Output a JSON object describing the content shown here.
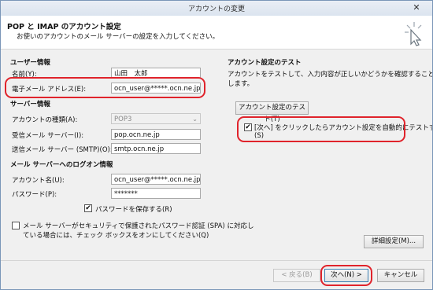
{
  "window": {
    "title": "アカウントの変更",
    "close": "✕"
  },
  "header": {
    "title": "POP と IMAP のアカウント設定",
    "subtitle": "お使いのアカウントのメール サーバーの設定を入力してください。"
  },
  "user_info": {
    "section": "ユーザー情報",
    "name_label": "名前(Y):",
    "name_value": "山田　太郎",
    "email_label": "電子メール アドレス(E):",
    "email_value": "ocn_user@*****.ocn.ne.jp"
  },
  "server_info": {
    "section": "サーバー情報",
    "type_label": "アカウントの種類(A):",
    "type_value": "POP3",
    "incoming_label": "受信メール サーバー(I):",
    "incoming_value": "pop.ocn.ne.jp",
    "outgoing_label": "送信メール サーバー (SMTP)(O):",
    "outgoing_value": "smtp.ocn.ne.jp"
  },
  "logon_info": {
    "section": "メール サーバーへのログオン情報",
    "account_label": "アカウント名(U):",
    "account_value": "ocn_user@*****.ocn.ne.jp",
    "password_label": "パスワード(P):",
    "password_value": "*******",
    "save_password_label": "パスワードを保存する(R)",
    "spa_label_1": "メール サーバーがセキュリティで保護されたパスワード認証 (SPA) に対応し",
    "spa_label_2": "ている場合には、チェック ボックスをオンにしてください(Q)"
  },
  "test": {
    "section": "アカウント設定のテスト",
    "desc_1": "アカウントをテストして、入力内容が正しいかどうかを確認することをお勧め",
    "desc_2": "します。",
    "test_button": "アカウント設定のテスト(T)",
    "auto_test_label_1": "[次へ] をクリックしたらアカウント設定を自動的にテストする",
    "auto_test_label_2": "(S)"
  },
  "buttons": {
    "advanced": "詳細設定(M)...",
    "back": "< 戻る(B)",
    "next": "次へ(N) >",
    "cancel": "キャンセル"
  },
  "check": "✔",
  "colors": {
    "highlight": "#e0232b"
  }
}
